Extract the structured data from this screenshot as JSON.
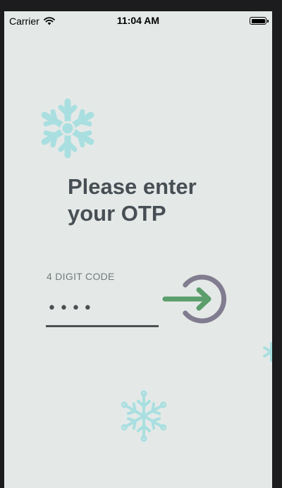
{
  "status_bar": {
    "carrier": "Carrier",
    "time": "11:04 AM",
    "icons": [
      "wifi-icon",
      "battery-icon"
    ]
  },
  "otp": {
    "title": "Please enter\nyour OTP",
    "code_label": "4 DIGIT CODE",
    "code_value": "••••",
    "submit_icon": "login-arrow-icon"
  },
  "colors": {
    "background": "#e4e9e7",
    "title_text": "#474f55",
    "snowflake": "#a9dfe0",
    "arrow": "#5b9d6b",
    "ring": "#817c8f",
    "underline": "#4d4f52"
  }
}
